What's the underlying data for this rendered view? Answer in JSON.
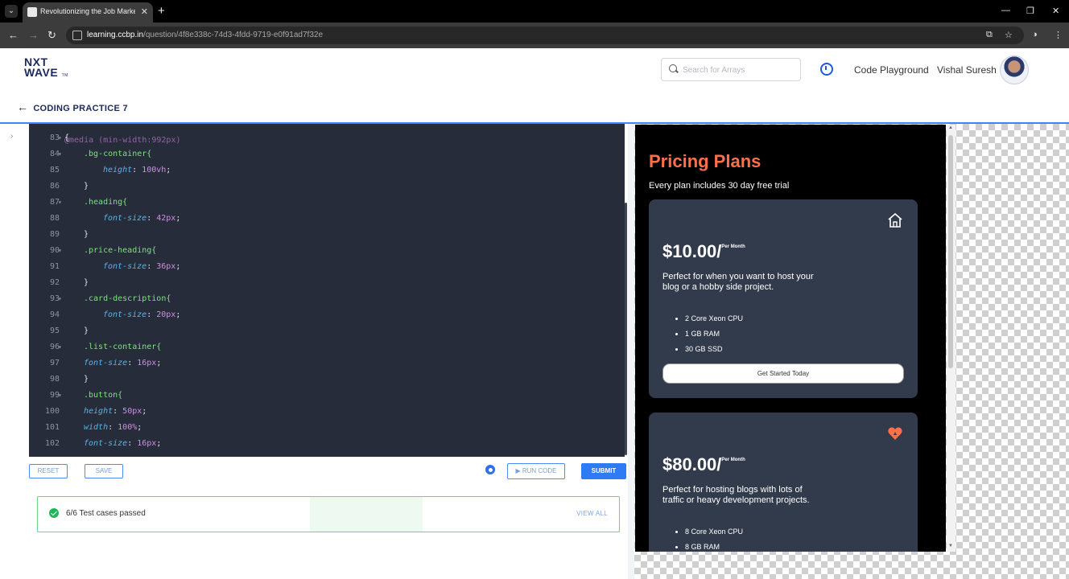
{
  "browser": {
    "tab_title": "Revolutionizing the Job Market",
    "url_host": "learning.ccbp.in",
    "url_path": "/question/4f8e338c-74d3-4fdd-9719-e0f91ad7f32e"
  },
  "header": {
    "logo_line1": "NXT",
    "logo_line2": "WAVE",
    "logo_tm": "TM",
    "search_placeholder": "Search for Arrays",
    "code_playground": "Code Playground",
    "username": "Vishal Suresh",
    "back_label": "CODING PRACTICE 7"
  },
  "editor": {
    "top_partial": "@media (min-width:992px)",
    "lines": [
      {
        "num": "83",
        "fold": true,
        "indent": 0,
        "sel": "{",
        "prop": "",
        "val": ""
      },
      {
        "num": "84",
        "fold": true,
        "indent": 1,
        "sel": ".bg-container{",
        "prop": "",
        "val": ""
      },
      {
        "num": "85",
        "fold": false,
        "indent": 2,
        "sel": "",
        "prop": "height",
        "val": "100vh"
      },
      {
        "num": "86",
        "fold": false,
        "indent": 1,
        "sel": "}",
        "prop": "",
        "val": ""
      },
      {
        "num": "87",
        "fold": true,
        "indent": 1,
        "sel": ".heading{",
        "prop": "",
        "val": ""
      },
      {
        "num": "88",
        "fold": false,
        "indent": 2,
        "sel": "",
        "prop": "font-size",
        "val": "42px"
      },
      {
        "num": "89",
        "fold": false,
        "indent": 1,
        "sel": "}",
        "prop": "",
        "val": ""
      },
      {
        "num": "90",
        "fold": true,
        "indent": 1,
        "sel": ".price-heading{",
        "prop": "",
        "val": ""
      },
      {
        "num": "91",
        "fold": false,
        "indent": 2,
        "sel": "",
        "prop": "font-size",
        "val": "36px"
      },
      {
        "num": "92",
        "fold": false,
        "indent": 1,
        "sel": "}",
        "prop": "",
        "val": ""
      },
      {
        "num": "93",
        "fold": true,
        "indent": 1,
        "sel": ".card-description{",
        "prop": "",
        "val": ""
      },
      {
        "num": "94",
        "fold": false,
        "indent": 2,
        "sel": "",
        "prop": "font-size",
        "val": "20px"
      },
      {
        "num": "95",
        "fold": false,
        "indent": 1,
        "sel": "}",
        "prop": "",
        "val": ""
      },
      {
        "num": "96",
        "fold": true,
        "indent": 1,
        "sel": ".list-container{",
        "prop": "",
        "val": ""
      },
      {
        "num": "97",
        "fold": false,
        "indent": 1,
        "sel": "",
        "prop": "font-size",
        "val": "16px"
      },
      {
        "num": "98",
        "fold": false,
        "indent": 1,
        "sel": "}",
        "prop": "",
        "val": ""
      },
      {
        "num": "99",
        "fold": true,
        "indent": 1,
        "sel": ".button{",
        "prop": "",
        "val": ""
      },
      {
        "num": "100",
        "fold": false,
        "indent": 1,
        "sel": "",
        "prop": "height",
        "val": "50px"
      },
      {
        "num": "101",
        "fold": false,
        "indent": 1,
        "sel": "",
        "prop": "width",
        "val": "100%"
      },
      {
        "num": "102",
        "fold": false,
        "indent": 1,
        "sel": "",
        "prop": "font-size",
        "val": "16px"
      }
    ]
  },
  "toolbar": {
    "reset": "RESET",
    "save": "SAVE",
    "run": "▶ RUN CODE",
    "submit": "SUBMIT"
  },
  "result": {
    "text": "6/6 Test cases passed",
    "view_all": "VIEW ALL"
  },
  "preview": {
    "title": "Pricing Plans",
    "subtitle": "Every plan includes 30 day free trial",
    "cards": [
      {
        "price": "$10.00/",
        "per": "Per Month",
        "desc": "Perfect for when you want to host your blog or a hobby side project.",
        "features": [
          "2 Core Xeon CPU",
          "1 GB RAM",
          "30 GB SSD"
        ],
        "button": "Get Started Today",
        "icon": "home-icon"
      },
      {
        "price": "$80.00/",
        "per": "Per Month",
        "desc": "Perfect for hosting blogs with lots of traffic or heavy development projects.",
        "features": [
          "8 Core Xeon CPU",
          "8 GB RAM"
        ],
        "icon": "heart-icon"
      }
    ]
  },
  "colors": {
    "accent": "#2f7bf5",
    "editor_bg": "#272c3a",
    "pricing_title": "#ff6f4a",
    "card_bg": "#323b4b",
    "success": "#1fb65a"
  }
}
